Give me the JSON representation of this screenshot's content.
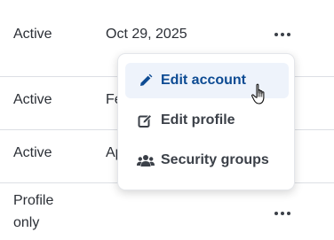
{
  "rows": [
    {
      "status": "Active",
      "date": "Oct 29, 2025",
      "more_icon": "ellipsis-horizontal-icon"
    },
    {
      "status": "Active",
      "date": "Fe",
      "more_icon": ""
    },
    {
      "status": "Active",
      "date": "Ap",
      "more_icon": ""
    },
    {
      "status": "Profile only",
      "date": "",
      "more_icon": "ellipsis-horizontal-icon"
    }
  ],
  "menu": {
    "items": [
      {
        "label": "Edit account",
        "icon": "pencil-icon",
        "active": true
      },
      {
        "label": "Edit profile",
        "icon": "edit-square-icon",
        "active": false
      },
      {
        "label": "Security groups",
        "icon": "users-group-icon",
        "active": false
      }
    ]
  },
  "colors": {
    "text": "#2b2f36",
    "active_item_text": "#0d4b93",
    "active_item_bg": "#eef3fb",
    "divider": "#dcdfe4"
  },
  "cursor": "hand-pointer-icon"
}
